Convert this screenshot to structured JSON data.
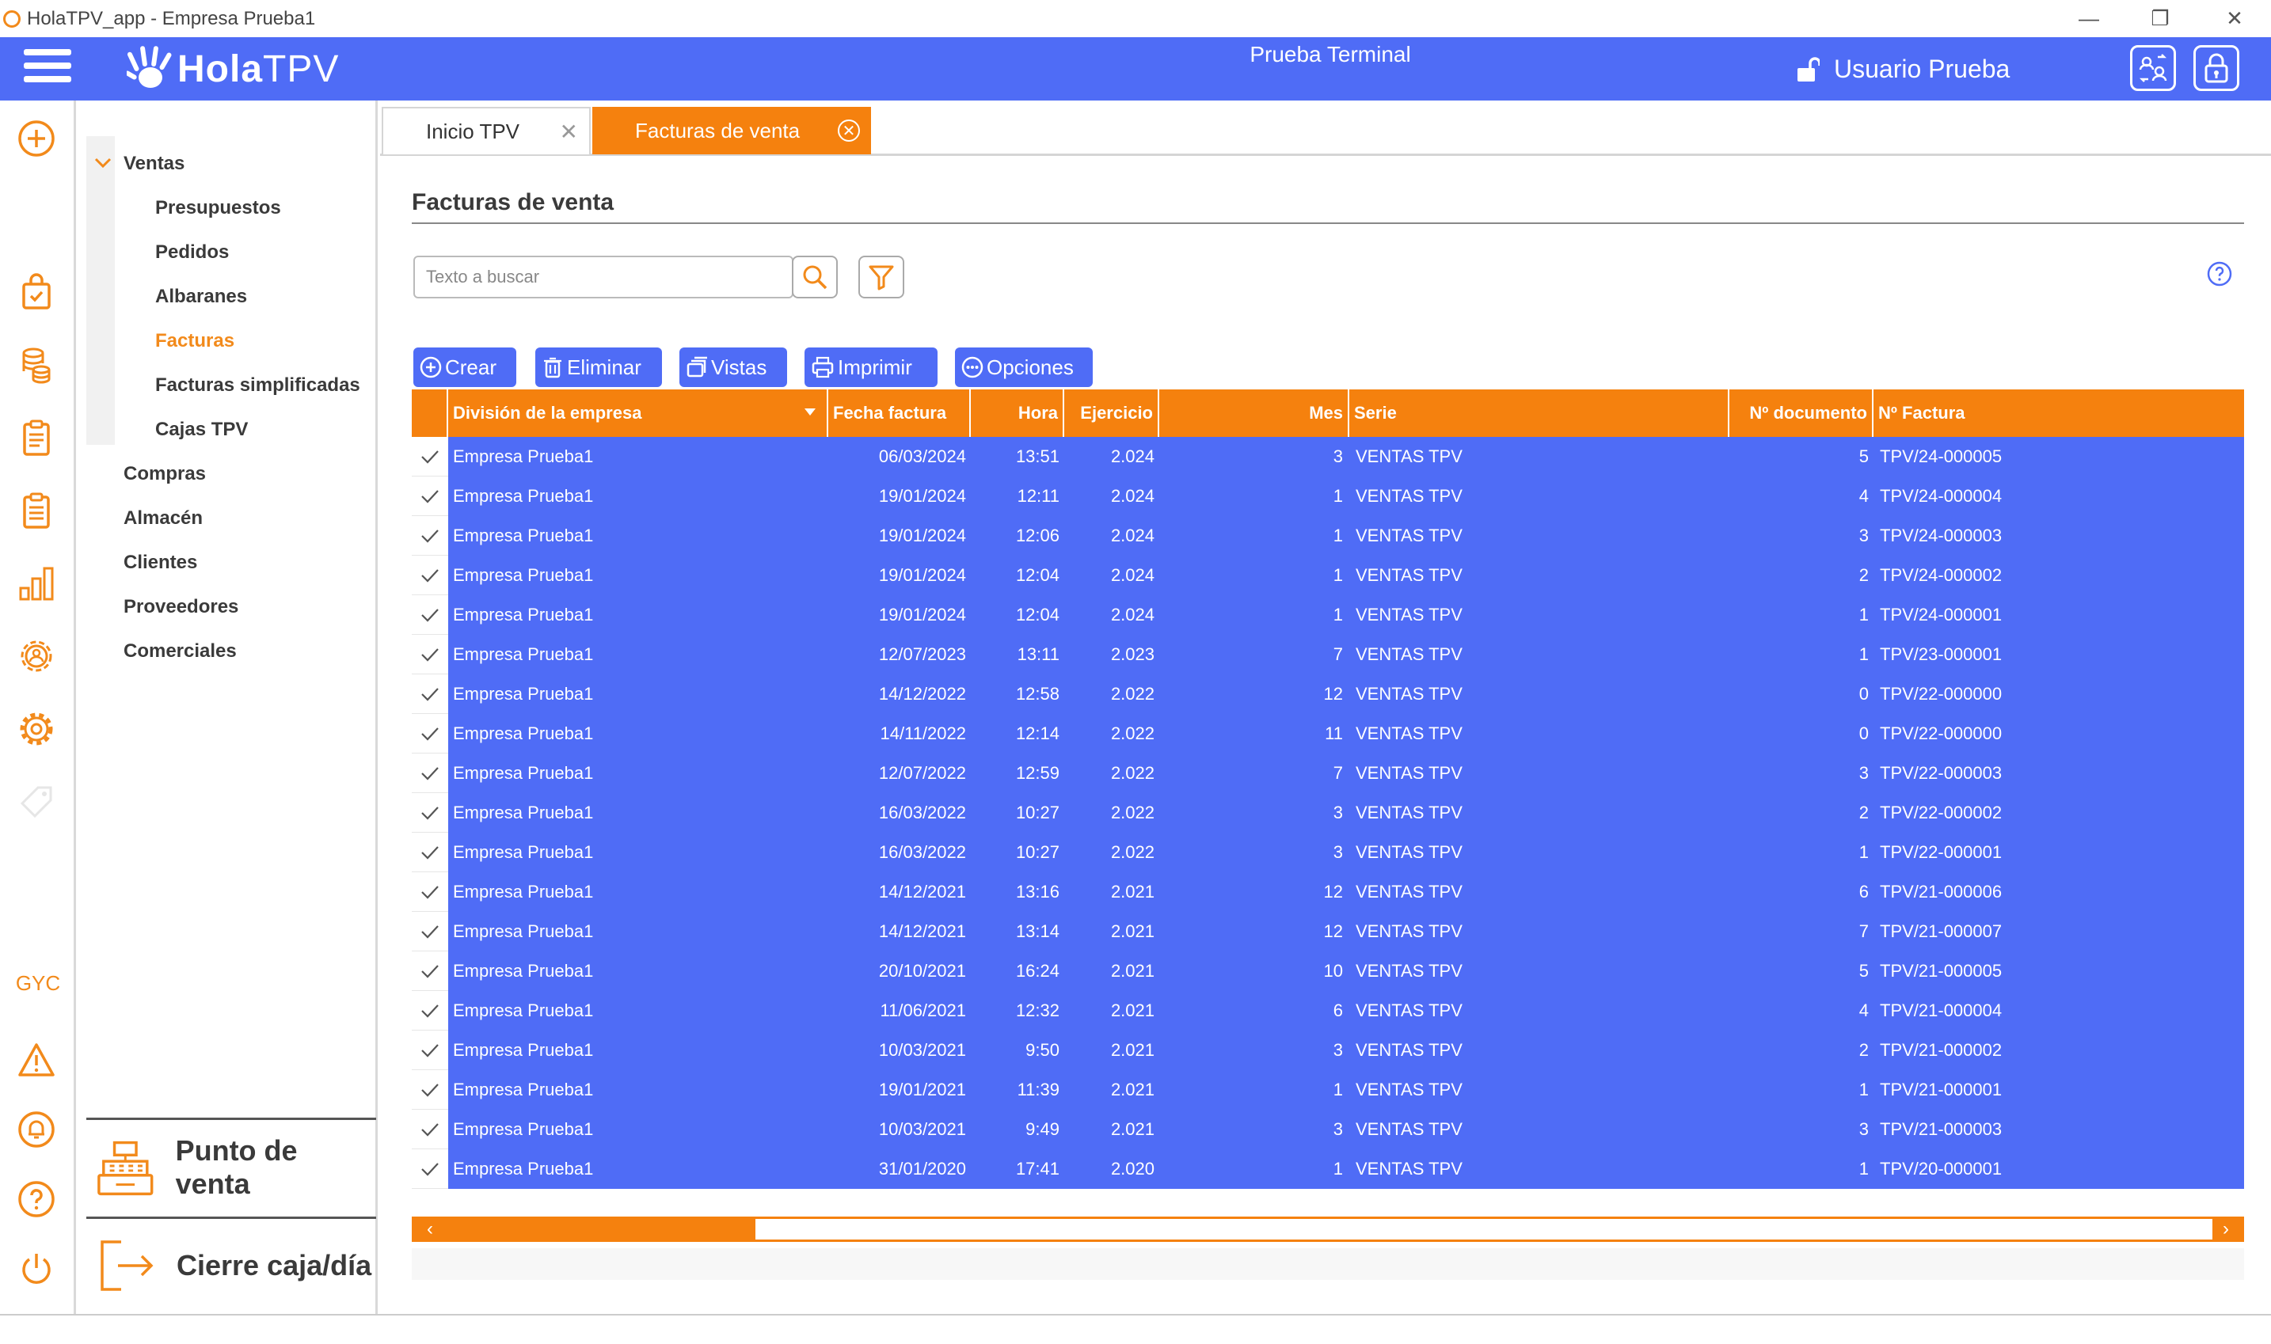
{
  "window": {
    "title": "HolaTPV_app - Empresa Prueba1",
    "minimize": "—",
    "restore": "❐",
    "close": "✕"
  },
  "header": {
    "logo_hola": "Hola",
    "logo_tpv": "TPV",
    "terminal": "Prueba Terminal",
    "user": "Usuario Prueba",
    "brand_color": "#4f6cf6",
    "accent_color": "#f5810e"
  },
  "rail": {
    "gyc": "GYC"
  },
  "menu": {
    "ventas": "Ventas",
    "ventas_items": [
      "Presupuestos",
      "Pedidos",
      "Albaranes",
      "Facturas",
      "Facturas simplificadas",
      "Cajas TPV"
    ],
    "sections": [
      "Compras",
      "Almacén",
      "Clientes",
      "Proveedores",
      "Comerciales"
    ],
    "pos_button": "Punto de venta",
    "close_button": "Cierre caja/día"
  },
  "tabs": [
    {
      "label": "Inicio TPV"
    },
    {
      "label": "Facturas de venta"
    }
  ],
  "page": {
    "title": "Facturas de venta",
    "search_placeholder": "Texto a buscar"
  },
  "toolbar": {
    "create": "Crear",
    "delete": "Eliminar",
    "views": "Vistas",
    "print": "Imprimir",
    "options": "Opciones"
  },
  "grid": {
    "columns": [
      "División de la empresa",
      "Fecha factura",
      "Hora",
      "Ejercicio",
      "Mes",
      "Serie",
      "Nº documento",
      "Nº Factura"
    ],
    "rows": [
      [
        "Empresa Prueba1",
        "06/03/2024",
        "13:51",
        "2.024",
        "3",
        "VENTAS TPV",
        "5",
        "TPV/24-000005"
      ],
      [
        "Empresa Prueba1",
        "19/01/2024",
        "12:11",
        "2.024",
        "1",
        "VENTAS TPV",
        "4",
        "TPV/24-000004"
      ],
      [
        "Empresa Prueba1",
        "19/01/2024",
        "12:06",
        "2.024",
        "1",
        "VENTAS TPV",
        "3",
        "TPV/24-000003"
      ],
      [
        "Empresa Prueba1",
        "19/01/2024",
        "12:04",
        "2.024",
        "1",
        "VENTAS TPV",
        "2",
        "TPV/24-000002"
      ],
      [
        "Empresa Prueba1",
        "19/01/2024",
        "12:04",
        "2.024",
        "1",
        "VENTAS TPV",
        "1",
        "TPV/24-000001"
      ],
      [
        "Empresa Prueba1",
        "12/07/2023",
        "13:11",
        "2.023",
        "7",
        "VENTAS TPV",
        "1",
        "TPV/23-000001"
      ],
      [
        "Empresa Prueba1",
        "14/12/2022",
        "12:58",
        "2.022",
        "12",
        "VENTAS TPV",
        "0",
        "TPV/22-000000"
      ],
      [
        "Empresa Prueba1",
        "14/11/2022",
        "12:14",
        "2.022",
        "11",
        "VENTAS TPV",
        "0",
        "TPV/22-000000"
      ],
      [
        "Empresa Prueba1",
        "12/07/2022",
        "12:59",
        "2.022",
        "7",
        "VENTAS TPV",
        "3",
        "TPV/22-000003"
      ],
      [
        "Empresa Prueba1",
        "16/03/2022",
        "10:27",
        "2.022",
        "3",
        "VENTAS TPV",
        "2",
        "TPV/22-000002"
      ],
      [
        "Empresa Prueba1",
        "16/03/2022",
        "10:27",
        "2.022",
        "3",
        "VENTAS TPV",
        "1",
        "TPV/22-000001"
      ],
      [
        "Empresa Prueba1",
        "14/12/2021",
        "13:16",
        "2.021",
        "12",
        "VENTAS TPV",
        "6",
        "TPV/21-000006"
      ],
      [
        "Empresa Prueba1",
        "14/12/2021",
        "13:14",
        "2.021",
        "12",
        "VENTAS TPV",
        "7",
        "TPV/21-000007"
      ],
      [
        "Empresa Prueba1",
        "20/10/2021",
        "16:24",
        "2.021",
        "10",
        "VENTAS TPV",
        "5",
        "TPV/21-000005"
      ],
      [
        "Empresa Prueba1",
        "11/06/2021",
        "12:32",
        "2.021",
        "6",
        "VENTAS TPV",
        "4",
        "TPV/21-000004"
      ],
      [
        "Empresa Prueba1",
        "10/03/2021",
        "9:50",
        "2.021",
        "3",
        "VENTAS TPV",
        "2",
        "TPV/21-000002"
      ],
      [
        "Empresa Prueba1",
        "19/01/2021",
        "11:39",
        "2.021",
        "1",
        "VENTAS TPV",
        "1",
        "TPV/21-000001"
      ],
      [
        "Empresa Prueba1",
        "10/03/2021",
        "9:49",
        "2.021",
        "3",
        "VENTAS TPV",
        "3",
        "TPV/21-000003"
      ],
      [
        "Empresa Prueba1",
        "31/01/2020",
        "17:41",
        "2.020",
        "1",
        "VENTAS TPV",
        "1",
        "TPV/20-000001"
      ]
    ]
  },
  "scroll": {
    "left": "‹",
    "right": "›"
  }
}
